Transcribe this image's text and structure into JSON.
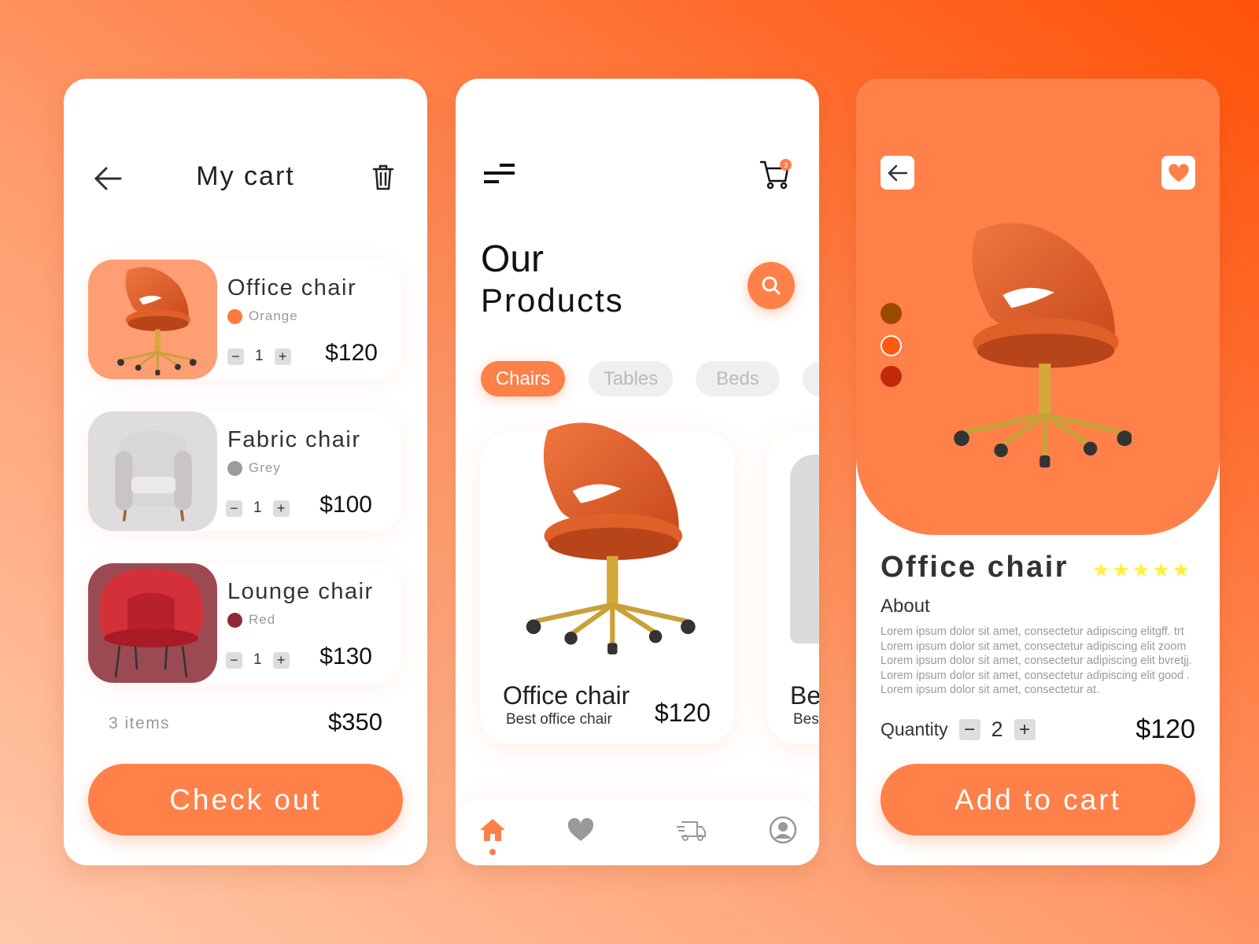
{
  "colors": {
    "accent": "#ff8049",
    "star": "#fff03c"
  },
  "cart": {
    "title": "My cart",
    "back_icon": "arrow-left-icon",
    "trash_icon": "trash-icon",
    "items": [
      {
        "name": "Office chair",
        "color_name": "Orange",
        "color": "#ff7a3d",
        "qty": "1",
        "price": "$120"
      },
      {
        "name": "Fabric chair",
        "color_name": "Grey",
        "color": "#a09a9a",
        "qty": "1",
        "price": "$100"
      },
      {
        "name": "Lounge chair",
        "color_name": "Red",
        "color": "#8e2a35",
        "qty": "1",
        "price": "$130"
      }
    ],
    "minus": "−",
    "plus": "+",
    "count": "3 items",
    "total": "$350",
    "checkout": "Check out"
  },
  "products": {
    "cart_badge": "3",
    "title_line1": "Our",
    "title_line2": "Products",
    "categories": [
      "Chairs",
      "Tables",
      "Beds"
    ],
    "cards": [
      {
        "name": "Office chair",
        "subtitle": "Best office chair",
        "price": "$120"
      },
      {
        "name": "Be",
        "subtitle": "Bes"
      }
    ],
    "nav": [
      "home-icon",
      "heart-icon",
      "delivery-truck-icon",
      "user-icon"
    ]
  },
  "detail": {
    "swatches": [
      "#9b4b00",
      "#ff5a0f",
      "#c02a0a"
    ],
    "name": "Office chair",
    "rating": 5,
    "about_label": "About",
    "about_lines": [
      "Lorem ipsum dolor sit amet, consectetur adipiscing elitgff. trt",
      "Lorem ipsum dolor sit amet, consectetur adipiscing elit zoom",
      "Lorem ipsum dolor sit amet, consectetur adipiscing elit bvretjj.",
      "Lorem ipsum dolor sit amet, consectetur adipiscing elit good .",
      "Lorem ipsum dolor sit amet, consectetur at."
    ],
    "quantity_label": "Quantity",
    "quantity": "2",
    "price": "$120",
    "add_to_cart": "Add to cart"
  }
}
